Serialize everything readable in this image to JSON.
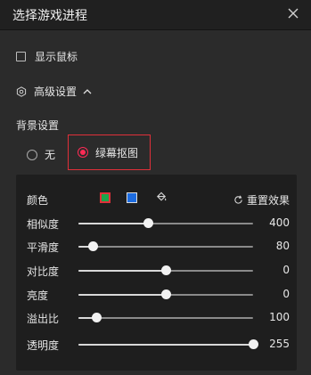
{
  "window": {
    "title": "选择游戏进程"
  },
  "options": {
    "show_cursor": {
      "label": "显示鼠标",
      "checked": false
    },
    "advanced": {
      "label": "高级设置",
      "expanded": true
    }
  },
  "background": {
    "title": "背景设置",
    "none_label": "无",
    "green_label": "绿幕抠图",
    "selected": "green"
  },
  "chroma": {
    "color_label": "颜色",
    "colors": {
      "green": "#1aa54a",
      "blue": "#1d6ce0",
      "accent": "#ff2b55"
    },
    "selected_color": "green",
    "reset_label": "重置效果",
    "sliders": [
      {
        "label": "相似度",
        "value": 400,
        "max": 1000
      },
      {
        "label": "平滑度",
        "value": 80,
        "max": 1000
      },
      {
        "label": "对比度",
        "value": 0,
        "min": -100,
        "max": 100
      },
      {
        "label": "亮度",
        "value": 0,
        "min": -100,
        "max": 100
      },
      {
        "label": "溢出比",
        "value": 100,
        "max": 1000
      },
      {
        "label": "透明度",
        "value": 255,
        "max": 255
      }
    ]
  }
}
